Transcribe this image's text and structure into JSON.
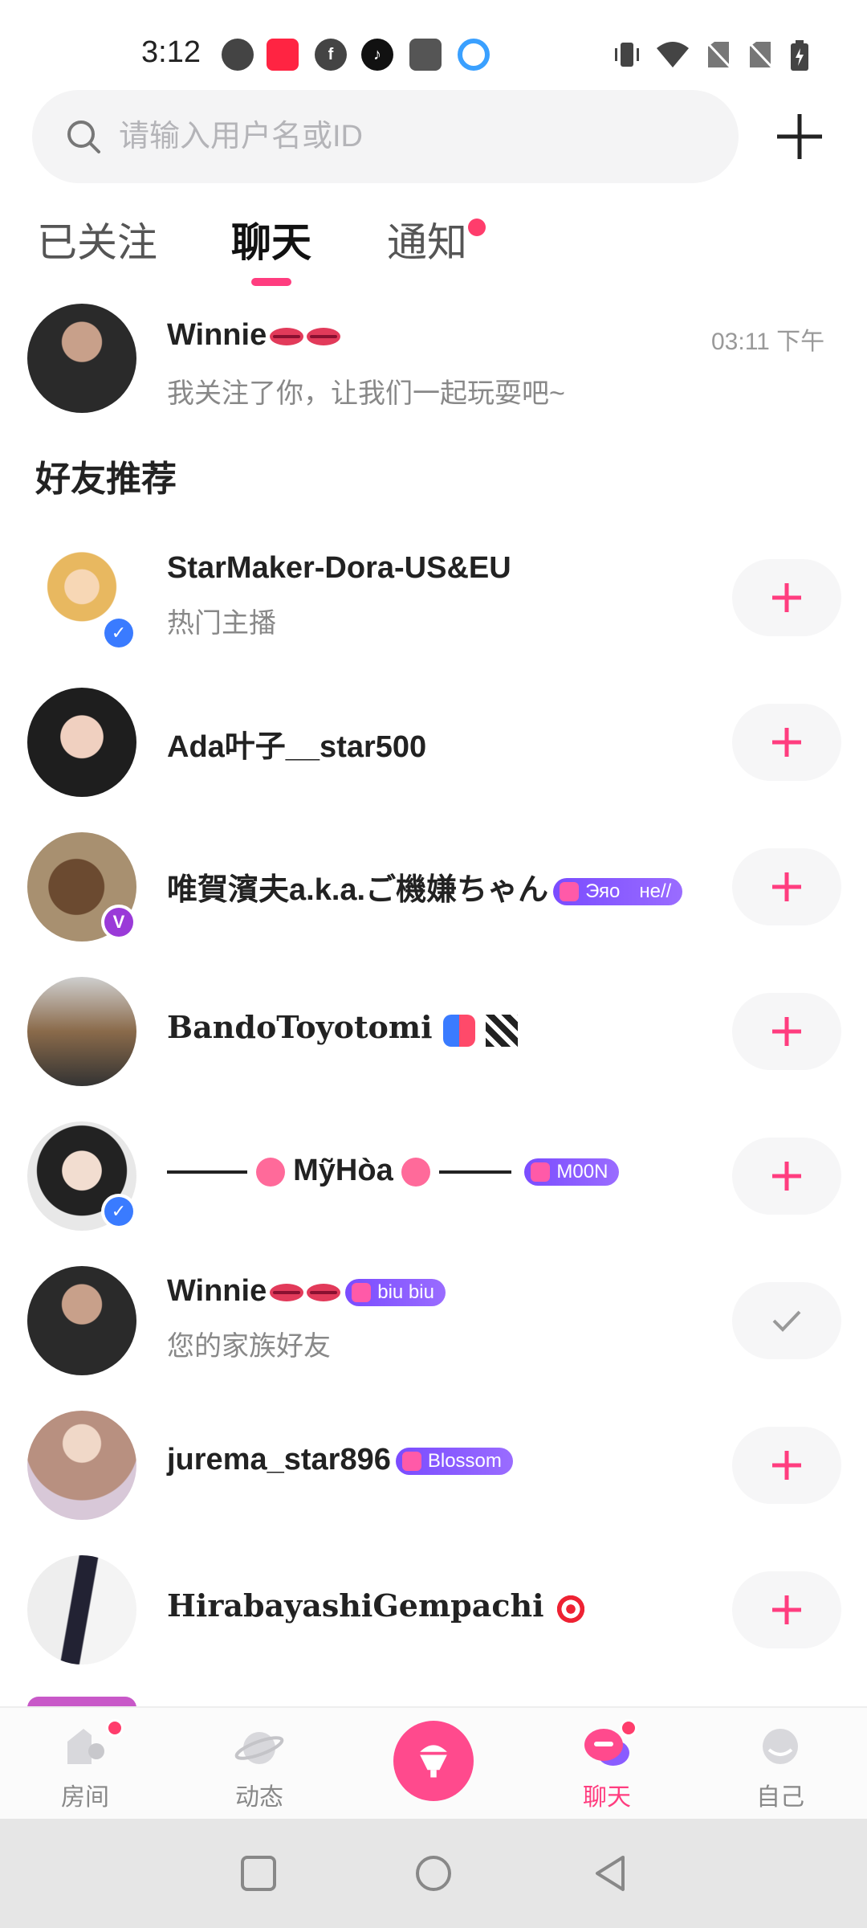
{
  "status_bar": {
    "time": "3:12"
  },
  "search": {
    "placeholder": "请输入用户名或ID"
  },
  "tabs": [
    {
      "label": "已关注",
      "active": false
    },
    {
      "label": "聊天",
      "active": true
    },
    {
      "label": "通知",
      "active": false,
      "has_dot": true
    }
  ],
  "chat": {
    "name": "Winnie",
    "message": "我关注了你，让我们一起玩耍吧~",
    "time": "03:11 下午"
  },
  "section_title": "好友推荐",
  "recommendations": [
    {
      "name": "StarMaker-Dora-US&EU",
      "subtitle": "热门主播",
      "badge": "",
      "followed": false
    },
    {
      "name": "Ada叶子__star500",
      "subtitle": "",
      "badge": "",
      "followed": false
    },
    {
      "name": "唯賀濱夫a.k.a.ご機嫌ちゃん",
      "subtitle": "",
      "badge": "Эяо　не//",
      "followed": false
    },
    {
      "name": "BandoToyotomi",
      "subtitle": "",
      "badge": "",
      "followed": false
    },
    {
      "name": "MỹHòa",
      "subtitle": "",
      "badge": "M00N",
      "followed": false
    },
    {
      "name": "Winnie",
      "subtitle": "您的家族好友",
      "badge": "biu biu",
      "followed": true
    },
    {
      "name": "jurema_star896",
      "subtitle": "",
      "badge": "Blossom",
      "followed": false
    },
    {
      "name": "HirabayashiGempachi",
      "subtitle": "",
      "badge": "",
      "followed": false
    }
  ],
  "bottom_nav": [
    {
      "label": "房间",
      "icon": "room-icon",
      "active": false,
      "has_dot": true
    },
    {
      "label": "动态",
      "icon": "planet-icon",
      "active": false,
      "has_dot": false
    },
    {
      "label": "",
      "icon": "microphone-icon",
      "active": false,
      "has_dot": false
    },
    {
      "label": "聊天",
      "icon": "chat-icon",
      "active": true,
      "has_dot": true
    },
    {
      "label": "自己",
      "icon": "profile-icon",
      "active": false,
      "has_dot": false
    }
  ],
  "colors": {
    "accent": "#ff3d7f",
    "badge": "#7a4cff"
  }
}
